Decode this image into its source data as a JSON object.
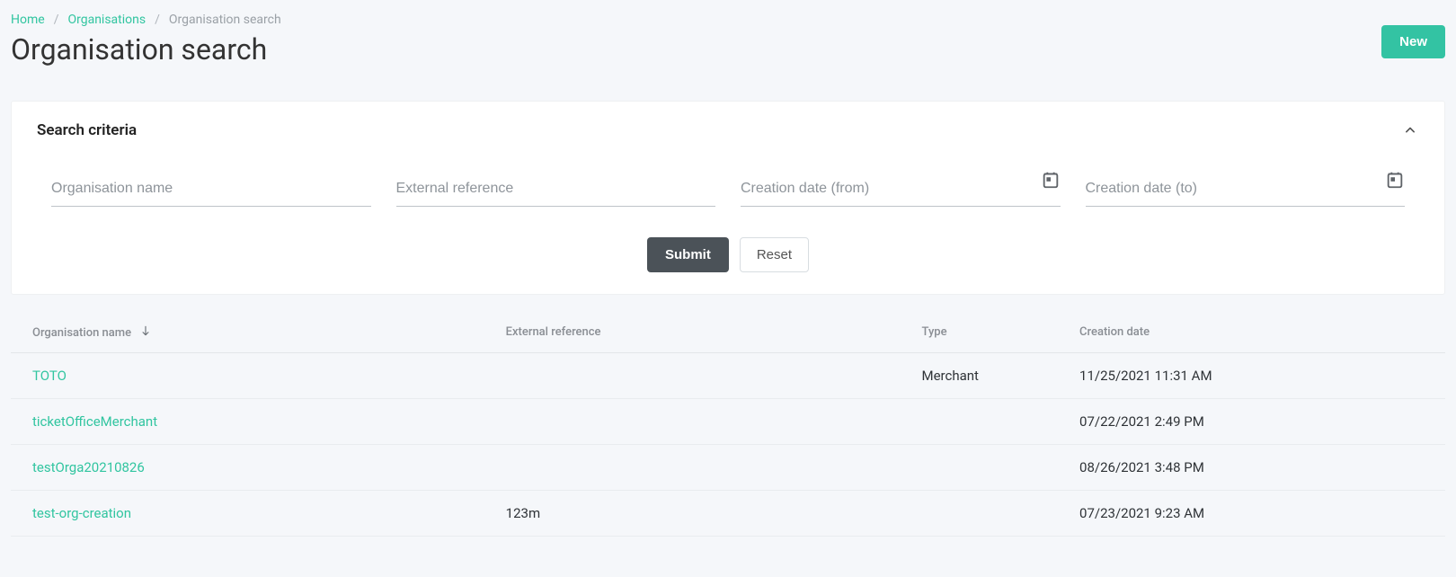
{
  "breadcrumb": {
    "home": "Home",
    "orgs": "Organisations",
    "current": "Organisation search"
  },
  "page_title": "Organisation search",
  "buttons": {
    "new": "New",
    "submit": "Submit",
    "reset": "Reset"
  },
  "search_card": {
    "title": "Search criteria",
    "fields": {
      "org_name_placeholder": "Organisation name",
      "ext_ref_placeholder": "External reference",
      "date_from_placeholder": "Creation date (from)",
      "date_to_placeholder": "Creation date (to)"
    }
  },
  "table": {
    "headers": {
      "org_name": "Organisation name",
      "ext_ref": "External reference",
      "type": "Type",
      "creation_date": "Creation date"
    },
    "rows": [
      {
        "name": "TOTO",
        "ext_ref": "",
        "type": "Merchant",
        "date": "11/25/2021 11:31 AM"
      },
      {
        "name": "ticketOfficeMerchant",
        "ext_ref": "",
        "type": "",
        "date": "07/22/2021 2:49 PM"
      },
      {
        "name": "testOrga20210826",
        "ext_ref": "",
        "type": "",
        "date": "08/26/2021 3:48 PM"
      },
      {
        "name": "test-org-creation",
        "ext_ref": "123m",
        "type": "",
        "date": "07/23/2021 9:23 AM"
      }
    ]
  }
}
